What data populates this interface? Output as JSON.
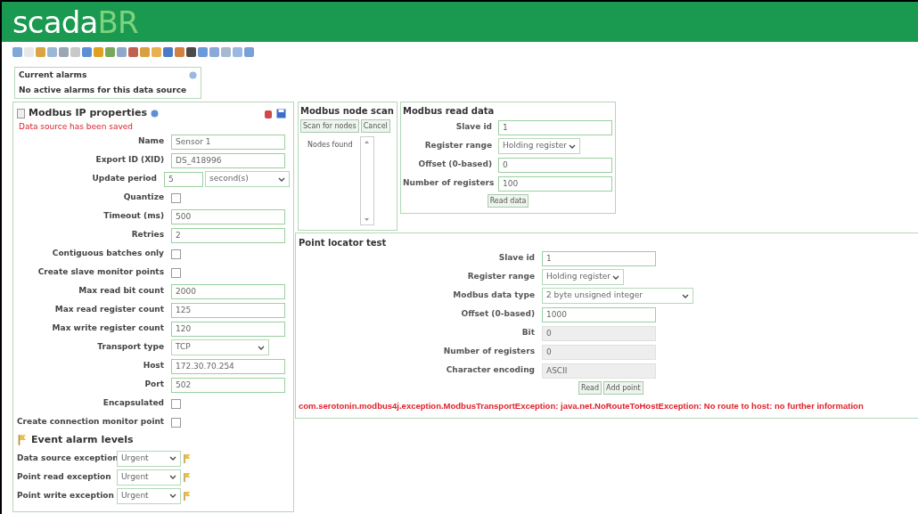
{
  "header": {
    "logo_main": "scada",
    "logo_accent": "BR"
  },
  "alarms": {
    "title": "Current alarms",
    "message": "No active alarms for this data source"
  },
  "properties": {
    "title": "Modbus IP properties",
    "status": "Data source has been saved",
    "fields": [
      {
        "kind": "text",
        "label": "Name",
        "value": "Sensor 1"
      },
      {
        "kind": "text",
        "label": "Export ID (XID)",
        "value": "DS_418996"
      },
      {
        "kind": "period",
        "label": "Update period",
        "value": "5",
        "unit": "second(s)"
      },
      {
        "kind": "checkbox",
        "label": "Quantize",
        "checked": false
      },
      {
        "kind": "text",
        "label": "Timeout (ms)",
        "value": "500"
      },
      {
        "kind": "text",
        "label": "Retries",
        "value": "2"
      },
      {
        "kind": "checkbox",
        "label": "Contiguous batches only",
        "checked": false
      },
      {
        "kind": "checkbox",
        "label": "Create slave monitor points",
        "checked": false
      },
      {
        "kind": "text",
        "label": "Max read bit count",
        "value": "2000"
      },
      {
        "kind": "text",
        "label": "Max read register count",
        "value": "125"
      },
      {
        "kind": "text",
        "label": "Max write register count",
        "value": "120"
      },
      {
        "kind": "select",
        "label": "Transport type",
        "value": "TCP"
      },
      {
        "kind": "text",
        "label": "Host",
        "value": "172.30.70.254"
      },
      {
        "kind": "text",
        "label": "Port",
        "value": "502"
      },
      {
        "kind": "checkbox",
        "label": "Encapsulated",
        "checked": false
      },
      {
        "kind": "checkbox",
        "label": "Create connection monitor point",
        "checked": false
      }
    ],
    "event_title": "Event alarm levels",
    "events": [
      {
        "label": "Data source exception",
        "value": "Urgent"
      },
      {
        "label": "Point read exception",
        "value": "Urgent"
      },
      {
        "label": "Point write exception",
        "value": "Urgent"
      }
    ]
  },
  "node_scan": {
    "title": "Modbus node scan",
    "buttons": [
      "Scan for nodes",
      "Cancel"
    ],
    "list_label": "Nodes found"
  },
  "read_data": {
    "title": "Modbus read data",
    "fields": [
      {
        "kind": "text",
        "label": "Slave id",
        "value": "1"
      },
      {
        "kind": "select",
        "label": "Register range",
        "value": "Holding register"
      },
      {
        "kind": "text",
        "label": "Offset (0-based)",
        "value": "0"
      },
      {
        "kind": "text",
        "label": "Number of registers",
        "value": "100"
      }
    ],
    "button": "Read data"
  },
  "locator": {
    "title": "Point locator test",
    "fields": [
      {
        "kind": "text",
        "label": "Slave id",
        "value": "1",
        "disabled": false
      },
      {
        "kind": "select",
        "label": "Register range",
        "value": "Holding register",
        "wide": false
      },
      {
        "kind": "select",
        "label": "Modbus data type",
        "value": "2 byte unsigned integer",
        "wide": true
      },
      {
        "kind": "text",
        "label": "Offset (0-based)",
        "value": "1000",
        "disabled": false
      },
      {
        "kind": "text",
        "label": "Bit",
        "value": "0",
        "disabled": true
      },
      {
        "kind": "text",
        "label": "Number of registers",
        "value": "0",
        "disabled": true
      },
      {
        "kind": "text",
        "label": "Character encoding",
        "value": "ASCII",
        "disabled": true
      }
    ],
    "buttons": [
      "Read",
      "Add point"
    ],
    "error": "com.serotonin.modbus4j.exception.ModbusTransportException: java.net.NoRouteToHostException: No route to host: no further information"
  }
}
